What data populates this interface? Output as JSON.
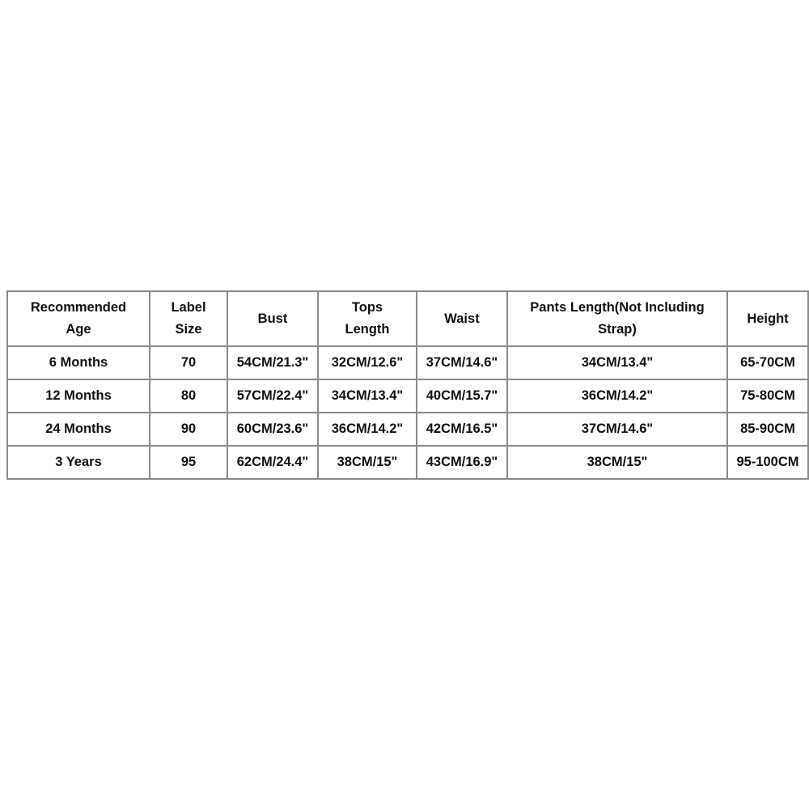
{
  "size_chart": {
    "headers": [
      "Recommended Age",
      "Label Size",
      "Bust",
      "Tops Length",
      "Waist",
      "Pants Length(Not Including Strap)",
      "Height"
    ],
    "rows": [
      [
        "6 Months",
        "70",
        "54CM/21.3\"",
        "32CM/12.6\"",
        "37CM/14.6\"",
        "34CM/13.4\"",
        "65-70CM"
      ],
      [
        "12 Months",
        "80",
        "57CM/22.4\"",
        "34CM/13.4\"",
        "40CM/15.7\"",
        "36CM/14.2\"",
        "75-80CM"
      ],
      [
        "24 Months",
        "90",
        "60CM/23.6\"",
        "36CM/14.2\"",
        "42CM/16.5\"",
        "37CM/14.6\"",
        "85-90CM"
      ],
      [
        "3 Years",
        "95",
        "62CM/24.4\"",
        "38CM/15\"",
        "43CM/16.9\"",
        "38CM/15\"",
        "95-100CM"
      ]
    ]
  }
}
